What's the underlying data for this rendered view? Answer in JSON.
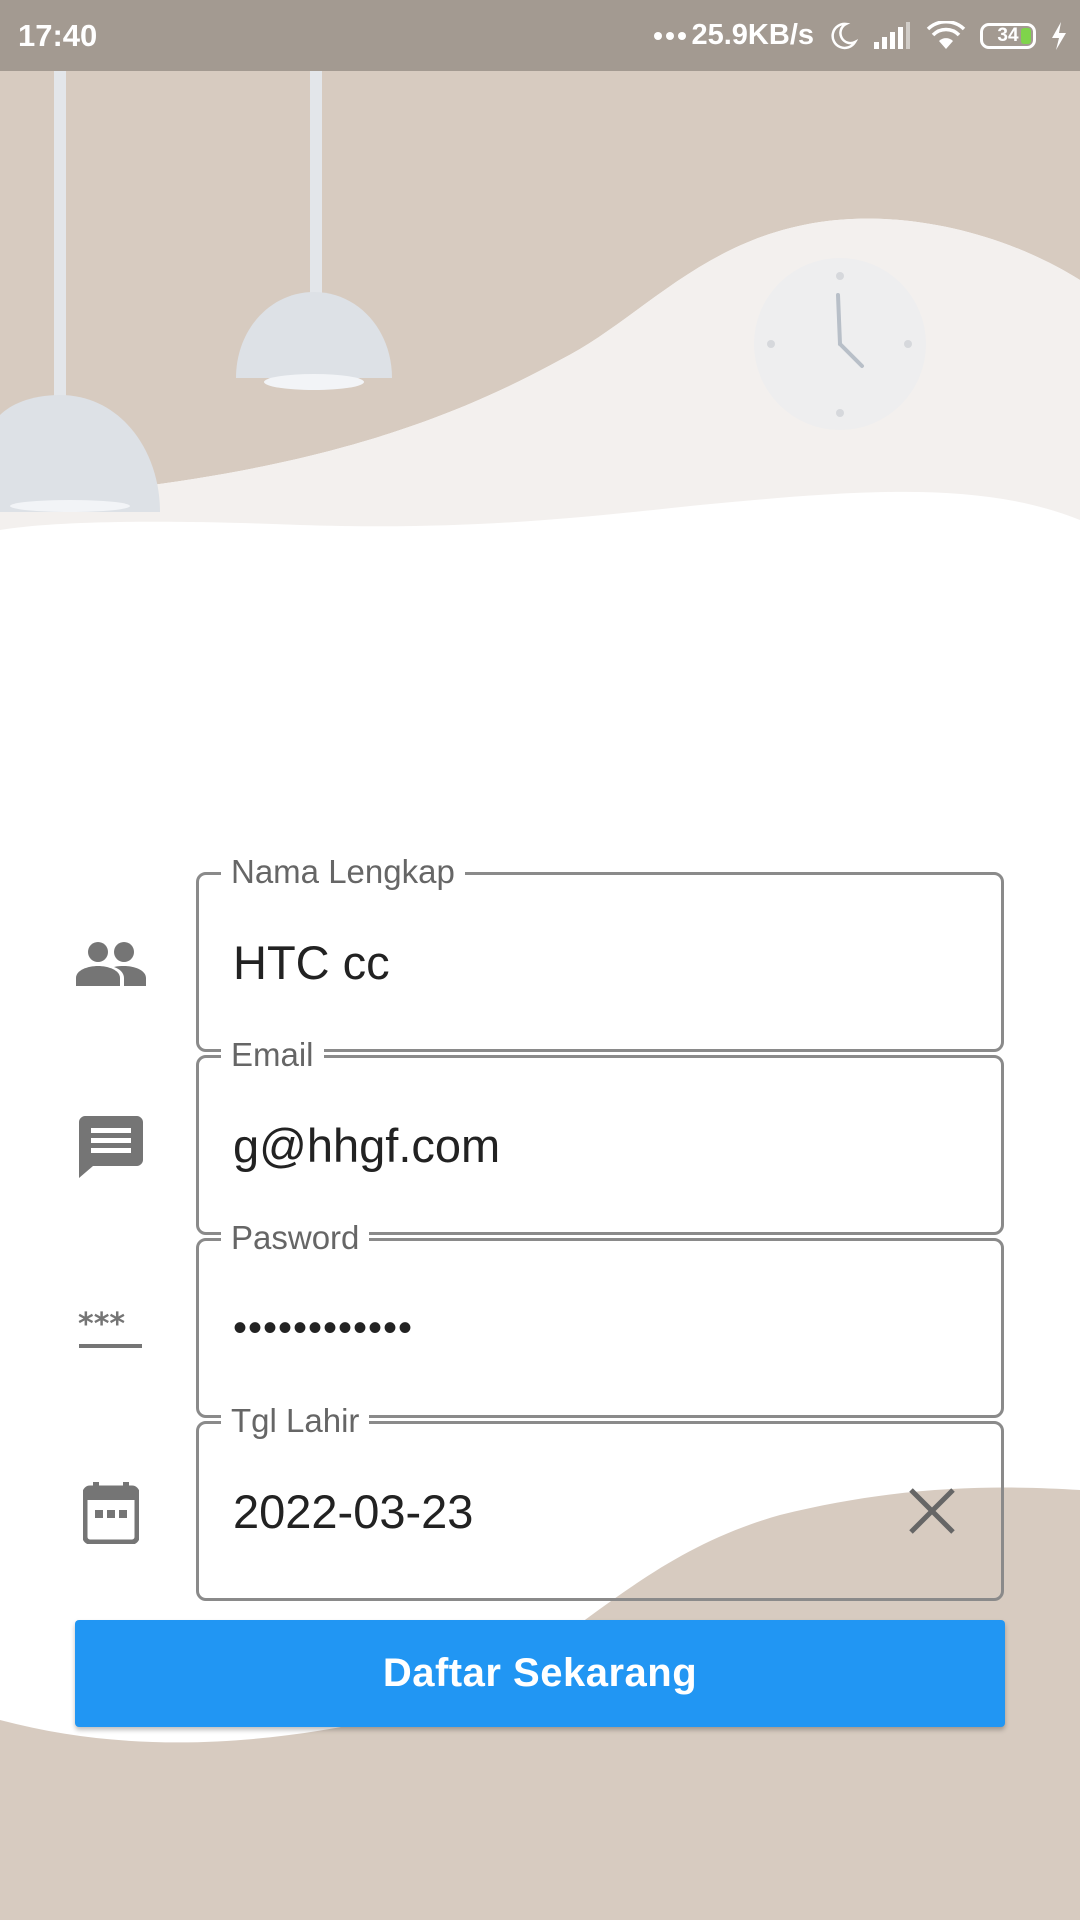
{
  "status_bar": {
    "time": "17:40",
    "network_speed": "25.9KB/s",
    "battery_level": "34",
    "icons": [
      "more-dots-icon",
      "moon-icon",
      "signal-icon",
      "wifi-icon",
      "battery-icon",
      "charging-bolt-icon"
    ]
  },
  "form": {
    "fields": [
      {
        "label": "Nama Lengkap",
        "value": "HTC cc",
        "icon": "people-icon"
      },
      {
        "label": "Email",
        "value": "g@hhgf.com",
        "icon": "message-icon"
      },
      {
        "label": "Pasword",
        "value": "••••••••••••",
        "icon": "password-icon"
      },
      {
        "label": "Tgl Lahir",
        "value": "2022-03-23",
        "icon": "calendar-icon",
        "clear_icon": "close-icon"
      }
    ],
    "submit_label": "Daftar Sekarang"
  },
  "colors": {
    "status_bar": "#a39a91",
    "beige": "#d7cbc0",
    "accent_button": "#2196f3",
    "field_border": "#8a8a8a",
    "icon_grey": "#757575"
  }
}
